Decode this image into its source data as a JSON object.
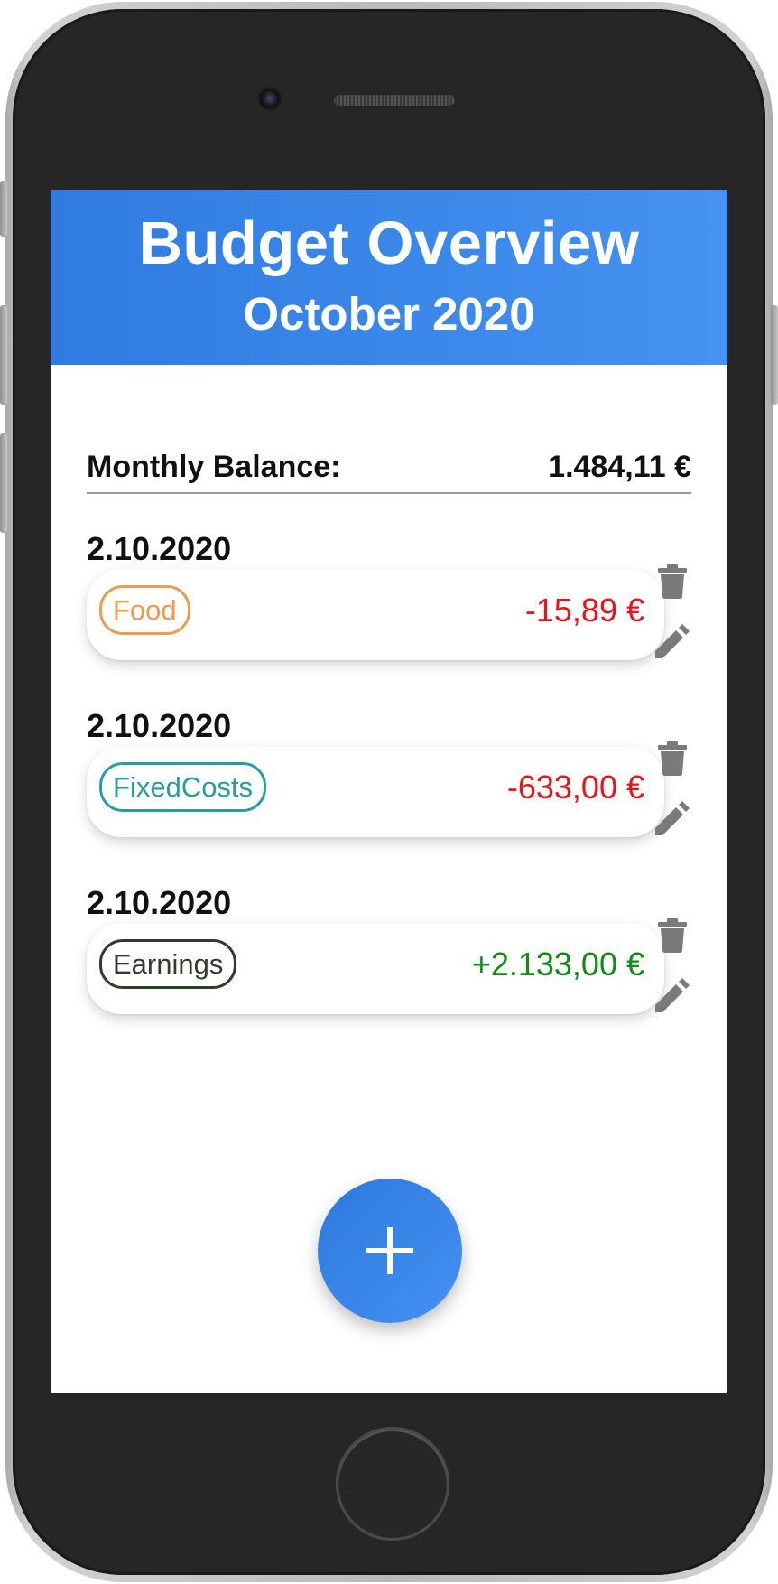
{
  "header": {
    "title": "Budget Overview",
    "subtitle": "October 2020"
  },
  "balance": {
    "label": "Monthly Balance:",
    "value": "1.484,11 €"
  },
  "entries": [
    {
      "date": "2.10.2020",
      "category": "Food",
      "category_color": "#ef9a4f",
      "amount": "-15,89 €",
      "amount_color": "#e8131b"
    },
    {
      "date": "2.10.2020",
      "category": "FixedCosts",
      "category_color": "#2a9aa5",
      "amount": "-633,00 €",
      "amount_color": "#e8131b"
    },
    {
      "date": "2.10.2020",
      "category": "Earnings",
      "category_color": "#2f3d2c",
      "amount": "+2.133,00 €",
      "amount_color": "#138a17"
    }
  ],
  "icons": {
    "delete": "trash-icon",
    "edit": "pencil-icon",
    "add": "plus-icon"
  },
  "colors": {
    "header_start": "#2f7be0",
    "header_end": "#4592f2",
    "icon_gray": "#7a7a7a"
  }
}
